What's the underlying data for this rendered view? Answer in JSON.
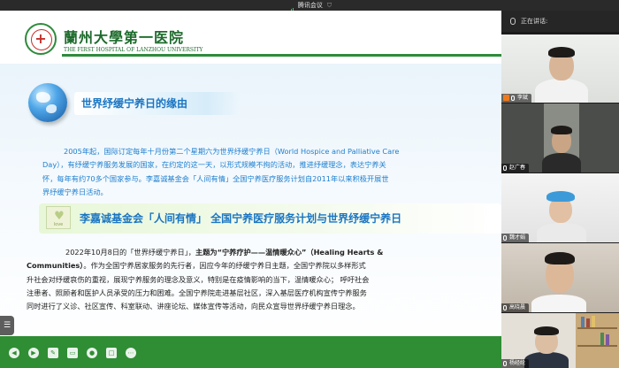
{
  "meeting": {
    "app_title": "腾讯会议"
  },
  "slide": {
    "hospital_name_cn": "蘭州大學第一医院",
    "hospital_name_en": "THE FIRST HOSPITAL OF LANZHOU UNIVERSITY",
    "section_title": "世界纾缓宁养日的缘由",
    "para1_lines": [
      "2005年起，国际订定每年十月份第二个星期六为世界纾缓宁养日（World Hospice and Palliative Care",
      "Day），有纾缓宁养服务发展的国家，在约定的这一天，以形式规模不拘的活动，推进纾缓理念，表达宁养关",
      "怀，每年有约70多个国家参与。李嘉诚基金会「人间有情」全国宁养医疗服务计划自2011年以来积极开展世",
      "界纾缓宁养日活动。"
    ],
    "banner_title": "李嘉诚基金会「人间有情」 全国宁养医疗服务计划与世界纾缓宁养日",
    "banner_card_text": "love",
    "para2": {
      "line1_normal": "2022年10月8日的「世界纾缓宁养日」，",
      "line1_bold": "主题为“宁养疗护——温情暖众心”（Healing Hearts &",
      "line2_bold": "Communities）",
      "line2_normal": "。作为全国宁养居家服务的先行者，因应今年的纾缓宁养日主题，全国宁养院以多样形式",
      "lines": [
        "升社会对纾缓哀伤的重视，展现宁养服务的理念及意义，特别是在疫情影响的当下，温情暖众心；  呼吁社会",
        "注患者、照顾者和医护人员承受的压力和困难。全国宁养院走进基层社区，深入基层医疗机构宣传宁养服务",
        "同时进行了义诊、社区宣传、科室联动、讲座论坛、媒体宣传等活动，向民众宣导世界纾缓宁养日理念。"
      ]
    }
  },
  "panel": {
    "speaking_label": "正在讲话:",
    "participants": [
      {
        "name": "李斌",
        "role": "host"
      },
      {
        "name": "赵广春",
        "role": "member"
      },
      {
        "name": "魏才娟",
        "role": "member"
      },
      {
        "name": "高晓晨",
        "role": "member"
      },
      {
        "name": "杨经纶",
        "role": "member"
      }
    ]
  },
  "colors": {
    "slide_green": "#2f8d34",
    "title_blue": "#1a75c2",
    "text_blue": "#1e7fd0",
    "host_orange": "#f07a1a"
  },
  "icons": [
    "signal-icon",
    "shield-icon",
    "mic-icon",
    "list-icon",
    "prev-icon",
    "next-icon",
    "pen-icon",
    "eraser-icon",
    "laser-icon",
    "shape-icon",
    "more-icon"
  ]
}
